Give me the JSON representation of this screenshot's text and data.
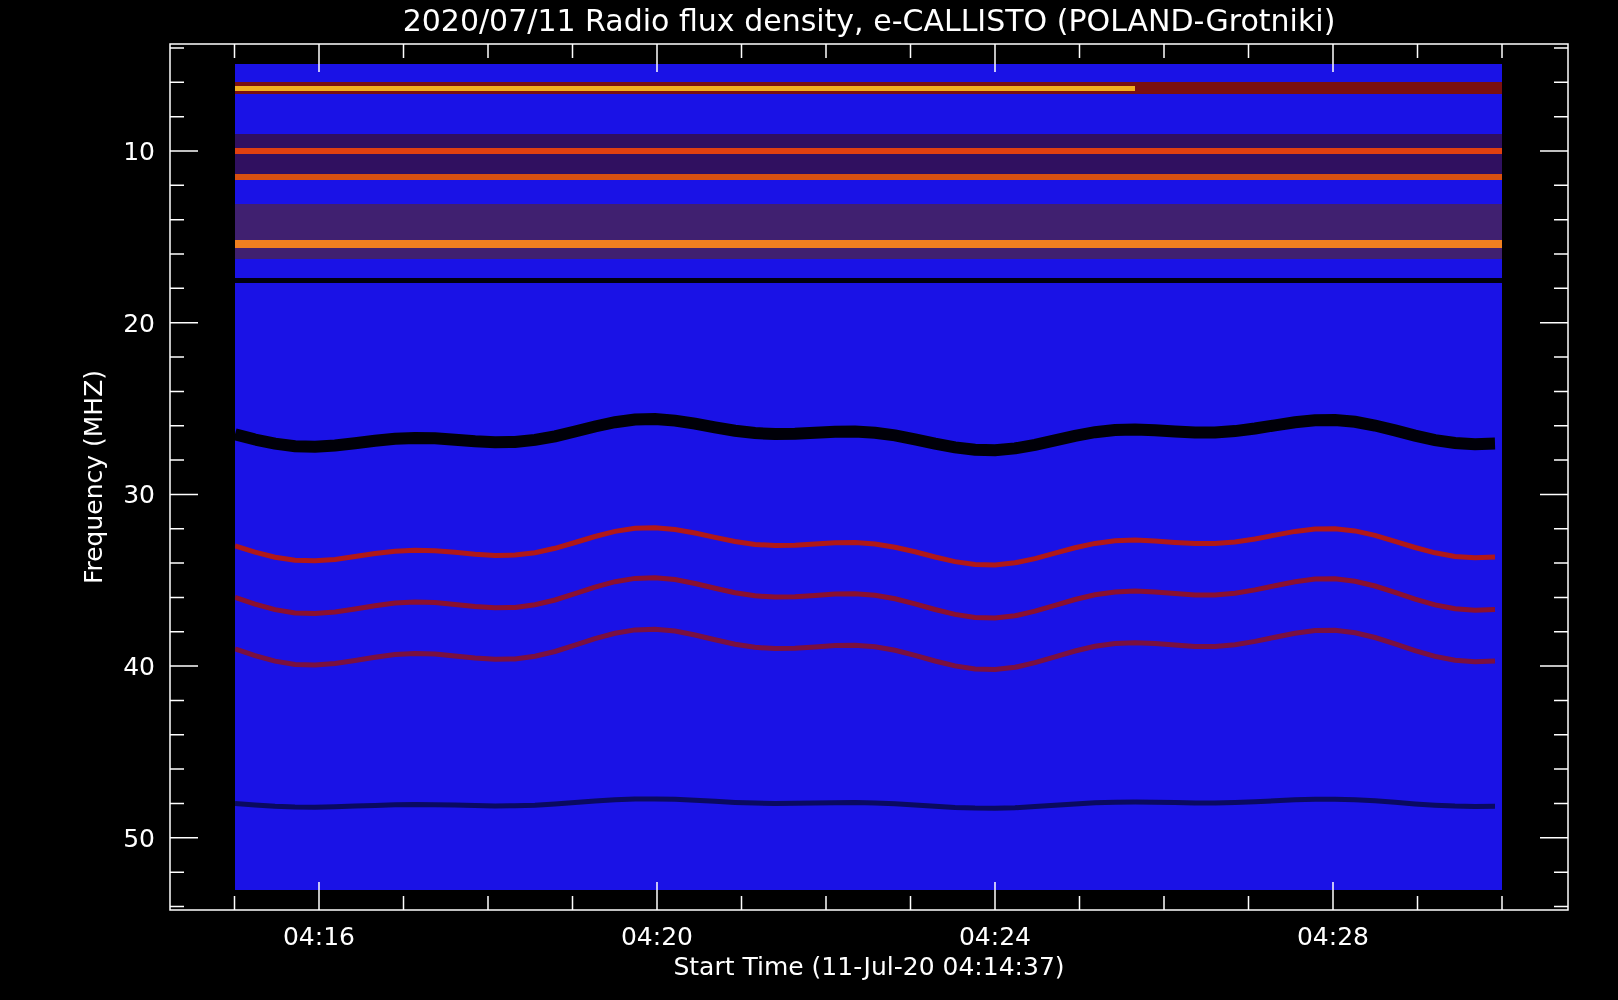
{
  "title": "2020/07/11  Radio flux density, e-CALLISTO (POLAND-Grotniki)",
  "axes": {
    "ylabel": "Frequency (MHZ)",
    "xlabel": "Start Time (11-Jul-20 04:14:37)",
    "yticks": [
      "10",
      "20",
      "30",
      "40",
      "50"
    ],
    "xticks": [
      "04:16",
      "04:20",
      "04:24",
      "04:28"
    ]
  }
}
